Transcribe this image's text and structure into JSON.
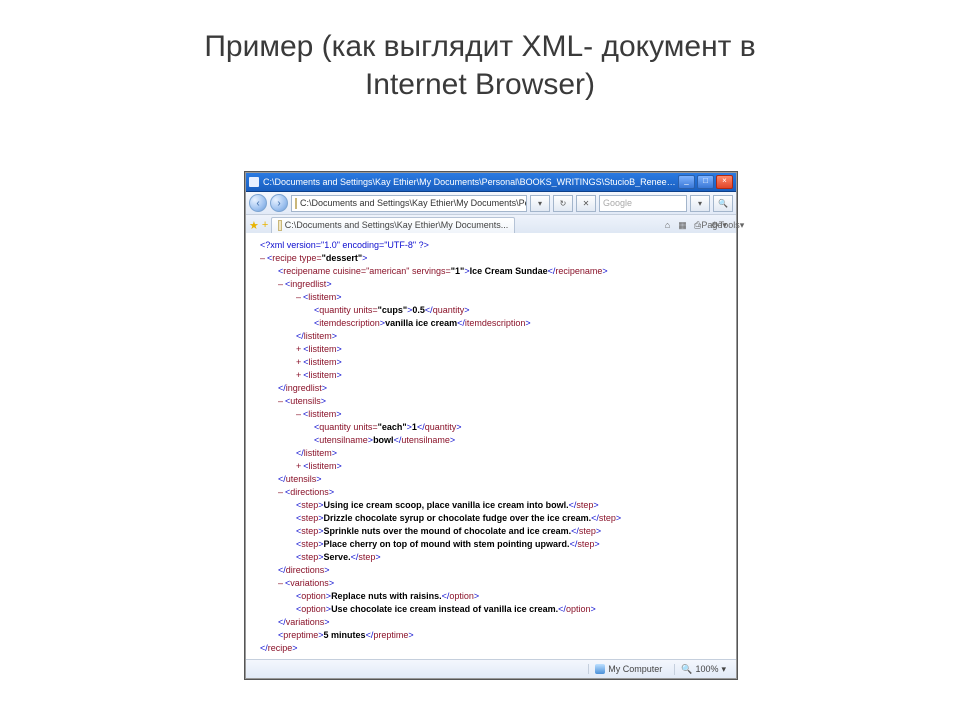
{
  "slide": {
    "title_line1": "Пример (как выглядит XML- документ в",
    "title_line2": "Internet Browser)"
  },
  "browser": {
    "titlebar_text": "C:\\Documents and Settings\\Kay Ethier\\My Documents\\Personal\\BOOKS_WRITINGS\\StucioB_Renee_...",
    "win_min": "_",
    "win_max": "□",
    "win_close": "×",
    "nav_back": "‹",
    "nav_fwd": "›",
    "address": "C:\\Documents and Settings\\Kay Ethier\\My Documents\\Persc",
    "addr_dd": "▾",
    "refresh": "↻",
    "stop": "✕",
    "search_placeholder": "Google",
    "search_dd": "▾",
    "search_go": "🔍",
    "star": "★",
    "star_plus": "+",
    "tab_text": "C:\\Documents and Settings\\Kay Ethier\\My Documents...",
    "toolbar": {
      "home": "⌂",
      "feeds": "▦",
      "print": "⎙",
      "page_label": "Page",
      "tools_label": "Tools",
      "dd": "▾"
    },
    "status": {
      "zone": "My Computer",
      "zoom": "100%"
    }
  },
  "xml": {
    "decl": "<?xml version=\"1.0\" encoding=\"UTF-8\" ?>",
    "recipe_open": {
      "tag": "recipe",
      "attrs": "type=",
      "val": "\"dessert\""
    },
    "recipename": {
      "tag": "recipename",
      "attrs": "cuisine=\"american\" servings=",
      "val": "\"1\"",
      "text": "Ice Cream Sundae"
    },
    "ingredlist_open": "ingredlist",
    "listitem": "listitem",
    "quantity_cups": {
      "tag": "quantity",
      "attrs": "units=",
      "val": "\"cups\"",
      "text": "0.5"
    },
    "itemdesc": {
      "tag": "itemdescription",
      "text": "vanilla ice cream"
    },
    "ingredlist_close": "ingredlist",
    "utensils_open": "utensils",
    "quantity_each": {
      "tag": "quantity",
      "attrs": "units=",
      "val": "\"each\"",
      "text": "1"
    },
    "utensilname": {
      "tag": "utensilname",
      "text": "bowl"
    },
    "utensils_close": "utensils",
    "directions_open": "directions",
    "step1": "Using ice cream scoop, place vanilla ice cream into bowl.",
    "step2": "Drizzle chocolate syrup or chocolate fudge over the ice cream.",
    "step3": "Sprinkle nuts over the mound of chocolate and ice cream.",
    "step4": "Place cherry on top of mound with stem pointing upward.",
    "step5": "Serve.",
    "step_tag": "step",
    "directions_close": "directions",
    "variations_open": "variations",
    "option1": "Replace nuts with raisins.",
    "option2": "Use chocolate ice cream instead of vanilla ice cream.",
    "option_tag": "option",
    "variations_close": "variations",
    "preptime": {
      "tag": "preptime",
      "text": "5 minutes"
    },
    "recipe_close": "recipe",
    "minus": "–",
    "plus": "+"
  }
}
